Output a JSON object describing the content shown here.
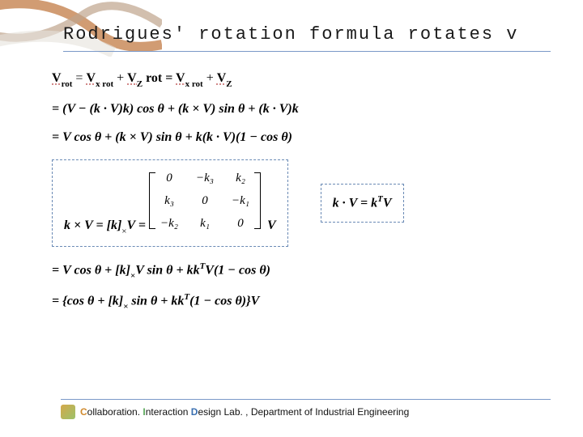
{
  "title": "Rodrigues' rotation formula rotates v",
  "eq1": {
    "lhs": "V",
    "lhs_sub": "rot",
    "eq": " = ",
    "t1": "V",
    "t1_sub": "x rot",
    "plus1": " + ",
    "t2": "V",
    "t2_sub": "Z",
    "note": " rot = ",
    "t3": "V",
    "t3_sub": "x rot",
    "plus2": " + ",
    "t4": "V",
    "t4_sub": "Z"
  },
  "eq2": "= (V − (k · V)k) cos θ + (k × V) sin θ + (k · V)k",
  "eq3": "= V cos θ + (k × V) sin θ + k(k · V)(1 − cos θ)",
  "cross": {
    "lhs": "k × V = [k]",
    "lhs_sub": "×",
    "lhs2": "V =",
    "after": "V",
    "matrix": [
      [
        "0",
        "−k₃",
        "k₂"
      ],
      [
        "k₃",
        "0",
        "−k₁"
      ],
      [
        "−k₂",
        "k₁",
        "0"
      ]
    ]
  },
  "dot": {
    "text": "k · V = k",
    "sup": "T",
    "after": "V"
  },
  "eq4": {
    "pre": "= V cos θ + [k]",
    "sub": "×",
    "mid": "V sin θ + kk",
    "sup": "T",
    "post": "V(1 − cos θ)"
  },
  "eq5": {
    "pre": "= {cos θ + [k]",
    "sub": "×",
    "mid": " sin θ + kk",
    "sup": "T",
    "post": "(1 − cos θ)}V"
  },
  "footer": {
    "c": "C",
    "c_rest": "ollaboration. ",
    "i": "I",
    "i_rest": "nteraction  ",
    "d": "D",
    "d_rest": "esign",
    "tail": " Lab. , Department of Industrial Engineering"
  }
}
